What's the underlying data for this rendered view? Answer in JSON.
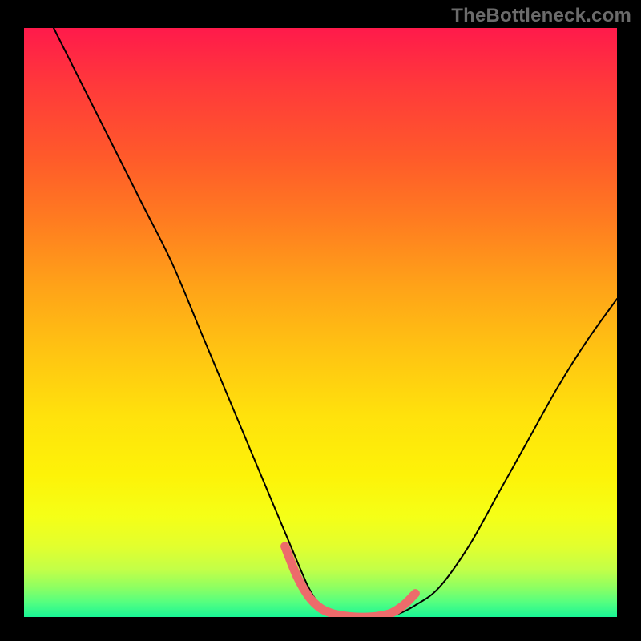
{
  "watermark": "TheBottleneck.com",
  "chart_data": {
    "type": "line",
    "title": "",
    "xlabel": "",
    "ylabel": "",
    "xlim": [
      0,
      100
    ],
    "ylim": [
      0,
      100
    ],
    "grid": false,
    "series": [
      {
        "name": "curve",
        "x": [
          5,
          10,
          15,
          20,
          25,
          30,
          35,
          40,
          45,
          48,
          50,
          52,
          55,
          57,
          60,
          63,
          66,
          70,
          75,
          80,
          85,
          90,
          95,
          100
        ],
        "y": [
          100,
          90,
          80,
          70,
          60,
          48,
          36,
          24,
          12,
          5,
          2,
          0.5,
          0,
          0,
          0,
          0.5,
          2,
          5,
          12,
          21,
          30,
          39,
          47,
          54
        ]
      }
    ],
    "highlight_segment": {
      "color": "#ed6b6b",
      "x": [
        44,
        46,
        48,
        50,
        52,
        54,
        56,
        58,
        60,
        62,
        64,
        66
      ],
      "y": [
        12,
        7,
        3.5,
        1.5,
        0.6,
        0.2,
        0,
        0,
        0.2,
        0.7,
        2,
        4
      ]
    },
    "background_gradient": {
      "top_color": "#ff1a4b",
      "bottom_color": "#19f596"
    }
  }
}
